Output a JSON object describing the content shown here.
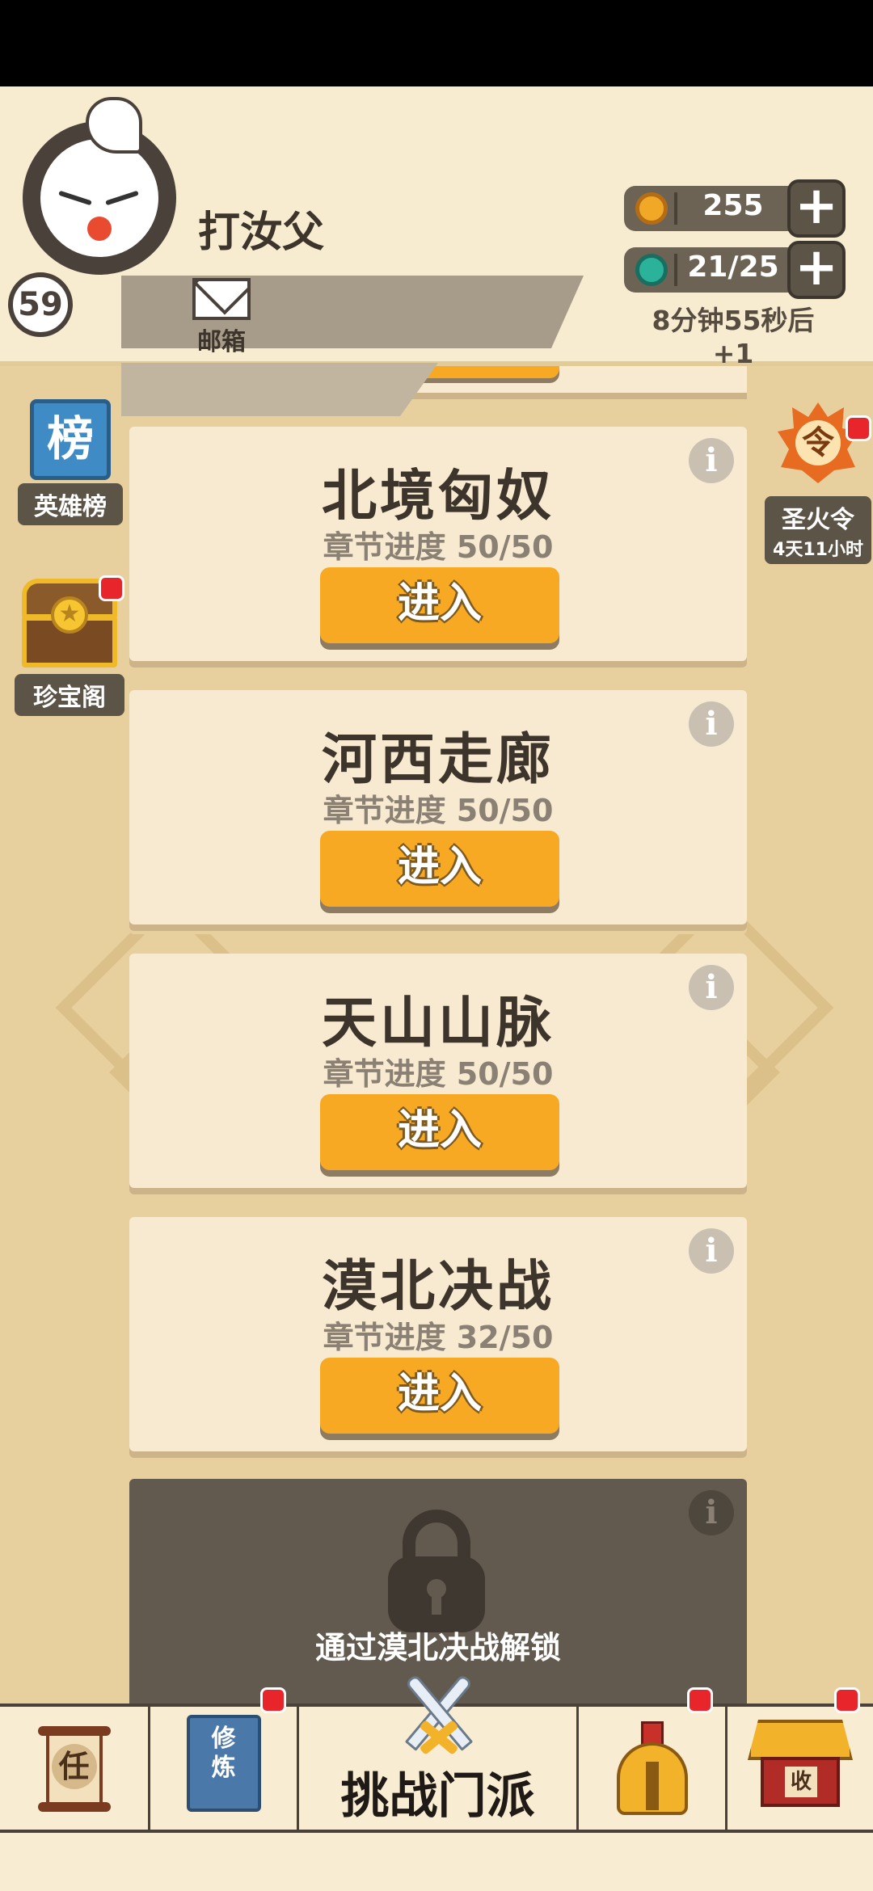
{
  "player": {
    "name": "打汝父",
    "level": "59",
    "mailbox_label": "邮箱"
  },
  "resources": {
    "coins": "255",
    "energy": "21/25",
    "energy_timer": "8分钟55秒后+1"
  },
  "side_left": {
    "rank_icon_char": "榜",
    "rank_label": "英雄榜",
    "treasure_label": "珍宝阁"
  },
  "side_right": {
    "token_char": "令",
    "token_label": "圣火令",
    "token_time": "4天11小时"
  },
  "chapters": [
    {
      "title": "北境匈奴",
      "progress": "章节进度 50/50",
      "button": "进入"
    },
    {
      "title": "河西走廊",
      "progress": "章节进度 50/50",
      "button": "进入"
    },
    {
      "title": "天山山脉",
      "progress": "章节进度 50/50",
      "button": "进入"
    },
    {
      "title": "漠北决战",
      "progress": "章节进度 32/50",
      "button": "进入"
    }
  ],
  "locked_chapter": {
    "unlock_text": "通过漠北决战解锁"
  },
  "bottom_nav": {
    "quest_char": "任",
    "cultivate_text": "修\n炼",
    "challenge_label": "挑战门派",
    "shop_char": "收"
  },
  "info_glyph": "i",
  "colors": {
    "enter_button": "#f7a924",
    "card_bg": "#f8ead0",
    "locked_bg": "#625a4f",
    "notification_dot": "#e8252a"
  },
  "icons": [
    "avatar-goose-icon",
    "mail-icon",
    "coin-icon",
    "energy-gem-icon",
    "plus-icon",
    "rank-banner-icon",
    "treasure-chest-icon",
    "holy-fire-token-icon",
    "info-icon",
    "lock-icon",
    "quest-scroll-icon",
    "cultivate-book-icon",
    "crossed-swords-icon",
    "helmet-icon",
    "shop-house-icon"
  ]
}
